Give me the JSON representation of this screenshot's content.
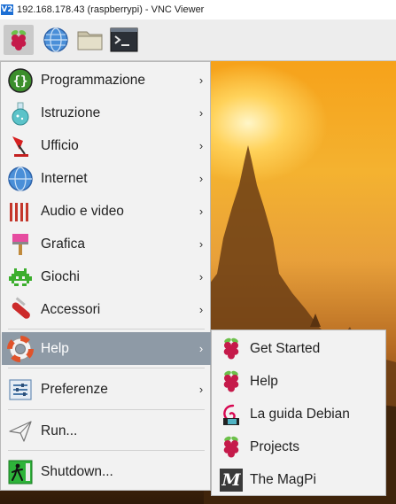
{
  "window": {
    "logo_text": "V2",
    "title": "192.168.178.43 (raspberrypi) - VNC Viewer"
  },
  "taskbar": {
    "buttons": [
      "raspberry-menu-icon",
      "web-browser-icon",
      "file-manager-icon",
      "terminal-icon"
    ]
  },
  "menu": {
    "items": [
      {
        "label": "Programmazione",
        "icon": "programming-icon"
      },
      {
        "label": "Istruzione",
        "icon": "education-icon"
      },
      {
        "label": "Ufficio",
        "icon": "office-icon"
      },
      {
        "label": "Internet",
        "icon": "internet-globe-icon"
      },
      {
        "label": "Audio e video",
        "icon": "audio-video-icon"
      },
      {
        "label": "Grafica",
        "icon": "graphics-icon"
      },
      {
        "label": "Giochi",
        "icon": "games-icon"
      },
      {
        "label": "Accessori",
        "icon": "accessories-icon"
      },
      {
        "label": "Help",
        "icon": "help-lifebuoy-icon",
        "active": true
      },
      {
        "label": "Preferenze",
        "icon": "preferences-icon"
      },
      {
        "label": "Run...",
        "icon": "run-icon"
      },
      {
        "label": "Shutdown...",
        "icon": "shutdown-icon"
      }
    ],
    "arrow": "›"
  },
  "help_submenu": {
    "items": [
      {
        "label": "Get Started",
        "icon": "raspberry-icon"
      },
      {
        "label": "Help",
        "icon": "raspberry-icon"
      },
      {
        "label": "La guida Debian",
        "icon": "debian-icon"
      },
      {
        "label": "Projects",
        "icon": "raspberry-icon"
      },
      {
        "label": "The MagPi",
        "icon": "magpi-icon"
      }
    ],
    "magpi_letter": "M"
  },
  "colors": {
    "active_item": "#8e9aa6",
    "menu_bg": "#f2f2f2",
    "raspberry_red": "#c51a4a",
    "raspberry_green": "#6cc04a"
  }
}
